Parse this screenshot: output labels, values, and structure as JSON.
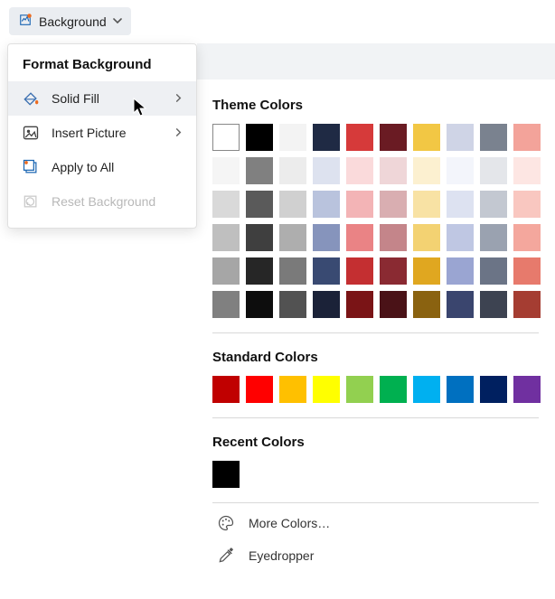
{
  "toolbar": {
    "label": "Background"
  },
  "menu": {
    "title": "Format Background",
    "solid_fill": "Solid Fill",
    "insert_picture": "Insert Picture",
    "apply_all": "Apply to All",
    "reset": "Reset Background"
  },
  "colors": {
    "theme_label": "Theme Colors",
    "standard_label": "Standard Colors",
    "recent_label": "Recent Colors",
    "more_colors": "More Colors…",
    "eyedropper": "Eyedropper",
    "theme_grid": [
      [
        "#ffffff",
        "#000000",
        "#f3f3f3",
        "#1f2a44",
        "#d63a3a",
        "#6a1b23",
        "#f2c744",
        "#cfd4e6",
        "#7a828f",
        "#f3a39a"
      ],
      [
        "#f5f5f5",
        "#808080",
        "#ececec",
        "#dde2ef",
        "#fadadb",
        "#efd6d8",
        "#fcf0d0",
        "#f3f5fb",
        "#e4e6ea",
        "#fde6e3"
      ],
      [
        "#d9d9d9",
        "#5a5a5a",
        "#d0d0d0",
        "#b9c3dd",
        "#f3b4b6",
        "#d9aeb1",
        "#f8e2a4",
        "#dde2f1",
        "#c3c8d1",
        "#f9c7c0"
      ],
      [
        "#bfbfbf",
        "#3f3f3f",
        "#aeaeae",
        "#8694bc",
        "#ea8385",
        "#c4858a",
        "#f3d272",
        "#bfc7e3",
        "#9aa2b0",
        "#f4a79d"
      ],
      [
        "#a6a6a6",
        "#262626",
        "#7a7a7a",
        "#394a72",
        "#c42f31",
        "#8a2a32",
        "#e0a720",
        "#9aa5d2",
        "#6b7486",
        "#e77a6c"
      ],
      [
        "#808080",
        "#0d0d0d",
        "#525252",
        "#1b2238",
        "#7a1416",
        "#4a1217",
        "#8a6210",
        "#3a456e",
        "#3d4351",
        "#a53d32"
      ]
    ],
    "standard_row": [
      "#c00000",
      "#ff0000",
      "#ffc000",
      "#ffff00",
      "#92d050",
      "#00b050",
      "#00b0f0",
      "#0070c0",
      "#002060",
      "#7030a0"
    ],
    "recent": [
      "#000000"
    ]
  }
}
